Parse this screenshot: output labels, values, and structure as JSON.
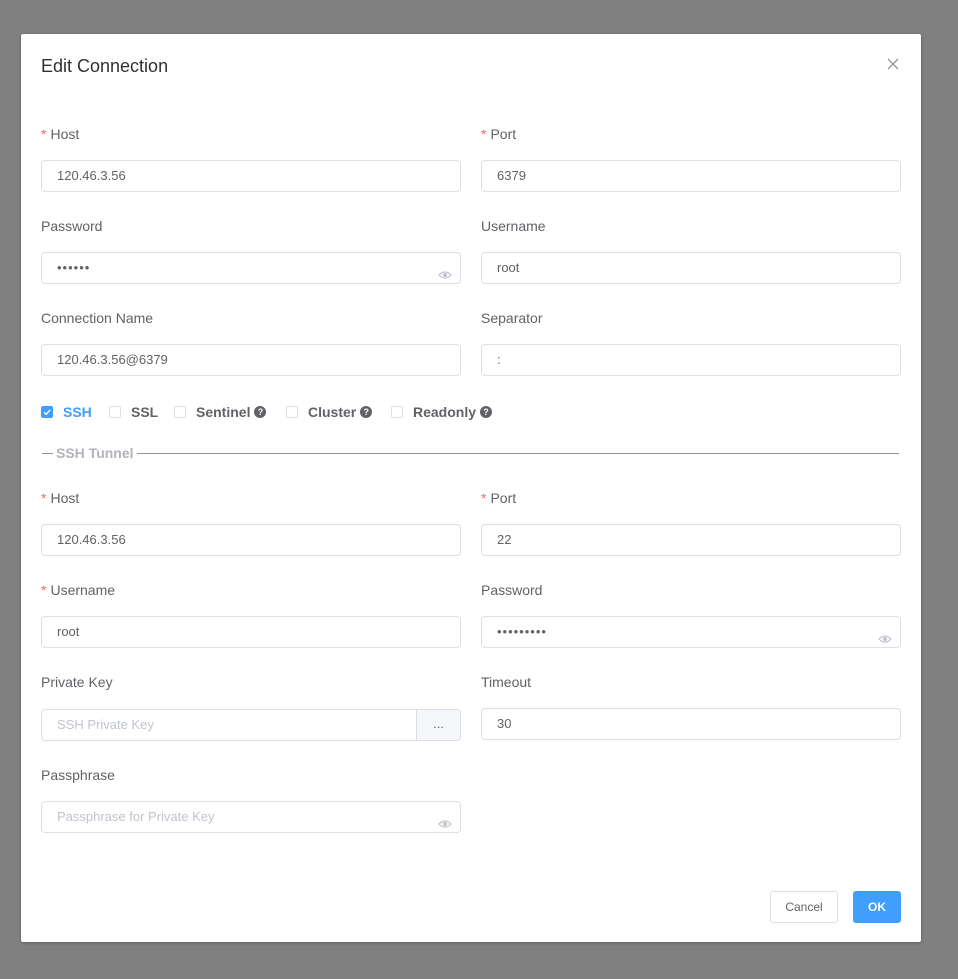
{
  "dialog": {
    "title": "Edit Connection"
  },
  "connection": {
    "host_label": "Host",
    "host_value": "120.46.3.56",
    "port_label": "Port",
    "port_value": "6379",
    "password_label": "Password",
    "password_value": "••••••",
    "username_label": "Username",
    "username_value": "root",
    "name_label": "Connection Name",
    "name_value": "120.46.3.56@6379",
    "separator_label": "Separator",
    "separator_value": ":"
  },
  "options": {
    "ssh": {
      "label": "SSH",
      "checked": true
    },
    "ssl": {
      "label": "SSL",
      "checked": false
    },
    "sentinel": {
      "label": "Sentinel",
      "checked": false
    },
    "cluster": {
      "label": "Cluster",
      "checked": false
    },
    "readonly": {
      "label": "Readonly",
      "checked": false
    },
    "help_glyph": "?"
  },
  "ssh_tunnel": {
    "legend": "SSH Tunnel",
    "host_label": "Host",
    "host_value": "120.46.3.56",
    "port_label": "Port",
    "port_value": "22",
    "username_label": "Username",
    "username_value": "root",
    "password_label": "Password",
    "password_value": "•••••••••",
    "private_key_label": "Private Key",
    "private_key_placeholder": "SSH Private Key",
    "browse_label": "...",
    "timeout_label": "Timeout",
    "timeout_value": "30",
    "passphrase_label": "Passphrase",
    "passphrase_placeholder": "Passphrase for Private Key"
  },
  "footer": {
    "cancel_label": "Cancel",
    "ok_label": "OK"
  },
  "colors": {
    "overlay": "#808080",
    "primary": "#409eff",
    "required": "#f56c6c"
  }
}
